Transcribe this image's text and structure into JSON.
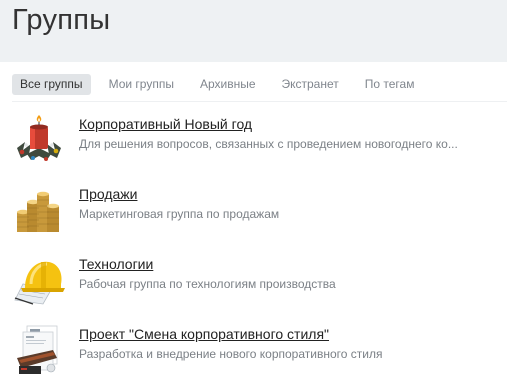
{
  "page": {
    "title": "Группы"
  },
  "tabs": [
    {
      "label": "Все группы",
      "active": true
    },
    {
      "label": "Мои группы",
      "active": false
    },
    {
      "label": "Архивные",
      "active": false
    },
    {
      "label": "Экстранет",
      "active": false
    },
    {
      "label": "По тегам",
      "active": false
    }
  ],
  "groups": [
    {
      "name": "Корпоративный Новый год",
      "description": "Для решения вопросов, связанных с проведением новогоднего ко...",
      "icon": "christmas-candle-icon"
    },
    {
      "name": "Продажи",
      "description": "Маркетинговая группа по продажам",
      "icon": "coins-stack-icon"
    },
    {
      "name": "Технологии",
      "description": "Рабочая группа по технологиям производства",
      "icon": "hard-hat-icon"
    },
    {
      "name": "Проект \"Смена корпоративного стиля\"",
      "description": "Разработка и внедрение нового корпоративного стиля",
      "icon": "brand-identity-icon"
    }
  ]
}
